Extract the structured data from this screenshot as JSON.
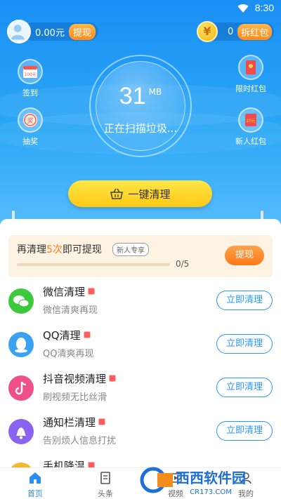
{
  "status_bar": {
    "time": "8:30",
    "icons": [
      "wifi-icon"
    ]
  },
  "header": {
    "cash": "0.00元",
    "withdraw_label": "提现",
    "coin_symbol": "¥",
    "coin_count": "0",
    "red_packet_label": "拆红包"
  },
  "side_left": [
    {
      "label": "签到",
      "icon": "calendar-icon",
      "icon_text": "100元"
    },
    {
      "label": "抽奖",
      "icon": "lottery-icon",
      "icon_text": "奖"
    }
  ],
  "side_right": [
    {
      "label": "限时红包",
      "icon": "red-envelope-icon"
    },
    {
      "label": "新人红包",
      "icon": "newcomer-envelope-icon",
      "icon_text": "10元"
    }
  ],
  "scan": {
    "value": "31",
    "unit": "MB",
    "status": "正在扫描垃圾..."
  },
  "clean_button": {
    "label": "一键清理",
    "icon": "basket-icon"
  },
  "task": {
    "title_prefix": "再清理",
    "title_highlight": "5次",
    "title_suffix": "即可提现",
    "badge": "新人专享",
    "progress_text": "0/5",
    "progress": 0,
    "button_label": "提现"
  },
  "items": [
    {
      "title": "微信清理",
      "subtitle": "微信清爽再现",
      "button": "立即清理",
      "icon": "wechat-icon",
      "color": "#3cc93b"
    },
    {
      "title": "QQ清理",
      "subtitle": "QQ清爽再现",
      "button": "立即清理",
      "icon": "qq-icon",
      "color": "#3aa2f2"
    },
    {
      "title": "抖音视频清理",
      "subtitle": "刷视频无比丝滑",
      "button": "立即清理",
      "icon": "tiktok-icon",
      "color": "#f0508a"
    },
    {
      "title": "通知栏清理",
      "subtitle": "告别烦人信息打扰",
      "button": "立即清理",
      "icon": "bell-icon",
      "color": "#8a63f0"
    },
    {
      "title": "手机降温",
      "subtitle": "",
      "button": "",
      "icon": "cooling-icon",
      "color": "#f5b731"
    }
  ],
  "tabs": [
    {
      "label": "首页",
      "icon": "home-icon",
      "active": true
    },
    {
      "label": "头条",
      "icon": "news-icon",
      "active": false
    },
    {
      "label": "视频",
      "icon": "video-icon",
      "active": false
    },
    {
      "label": "我的",
      "icon": "profile-icon",
      "active": false
    }
  ],
  "watermark": {
    "main": "西西软件园",
    "sub": "CR173.COM"
  },
  "colors": {
    "primary": "#2a97f0",
    "accent": "#ff7a1a",
    "button_yellow": "#ffd42a"
  }
}
